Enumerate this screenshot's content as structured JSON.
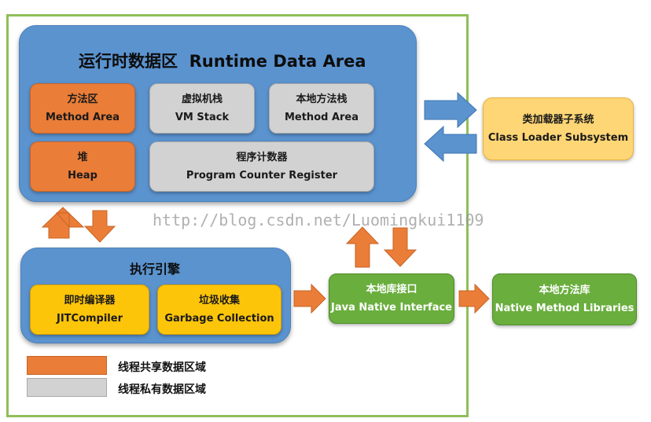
{
  "runtime": {
    "title": "运行时数据区  Runtime Data Area"
  },
  "method_area": {
    "cn": "方法区",
    "en": "Method Area"
  },
  "vm_stack": {
    "cn": "虚拟机栈",
    "en": "VM Stack"
  },
  "native_stack": {
    "cn": "本地方法栈",
    "en": "Method Area"
  },
  "heap": {
    "cn": "堆",
    "en": "Heap"
  },
  "pc_register": {
    "cn": "程序计数器",
    "en": "Program Counter Register"
  },
  "class_loader": {
    "cn": "类加载器子系统",
    "en": "Class Loader Subsystem"
  },
  "engine": {
    "title": "执行引擎"
  },
  "jit": {
    "cn": "即时编译器",
    "en": "JITCompiler"
  },
  "gc": {
    "cn": "垃圾收集",
    "en": "Garbage Collection"
  },
  "jni": {
    "cn": "本地库接口",
    "en": "Java Native Interface"
  },
  "native_libs": {
    "cn": "本地方法库",
    "en": "Native Method Libraries"
  },
  "watermark": "http://blog.csdn.net/Luomingkui1109",
  "legend": {
    "shared": "线程共享数据区域",
    "private": "线程私有数据区域"
  },
  "colors": {
    "shared_area": "#ea7d38",
    "private_area": "#d2d2d2",
    "runtime_bg": "#5b93cf",
    "engine_component": "#fdc50a",
    "native_component": "#6aae3e",
    "class_loader": "#ffd675",
    "frame": "#8fbf58"
  }
}
